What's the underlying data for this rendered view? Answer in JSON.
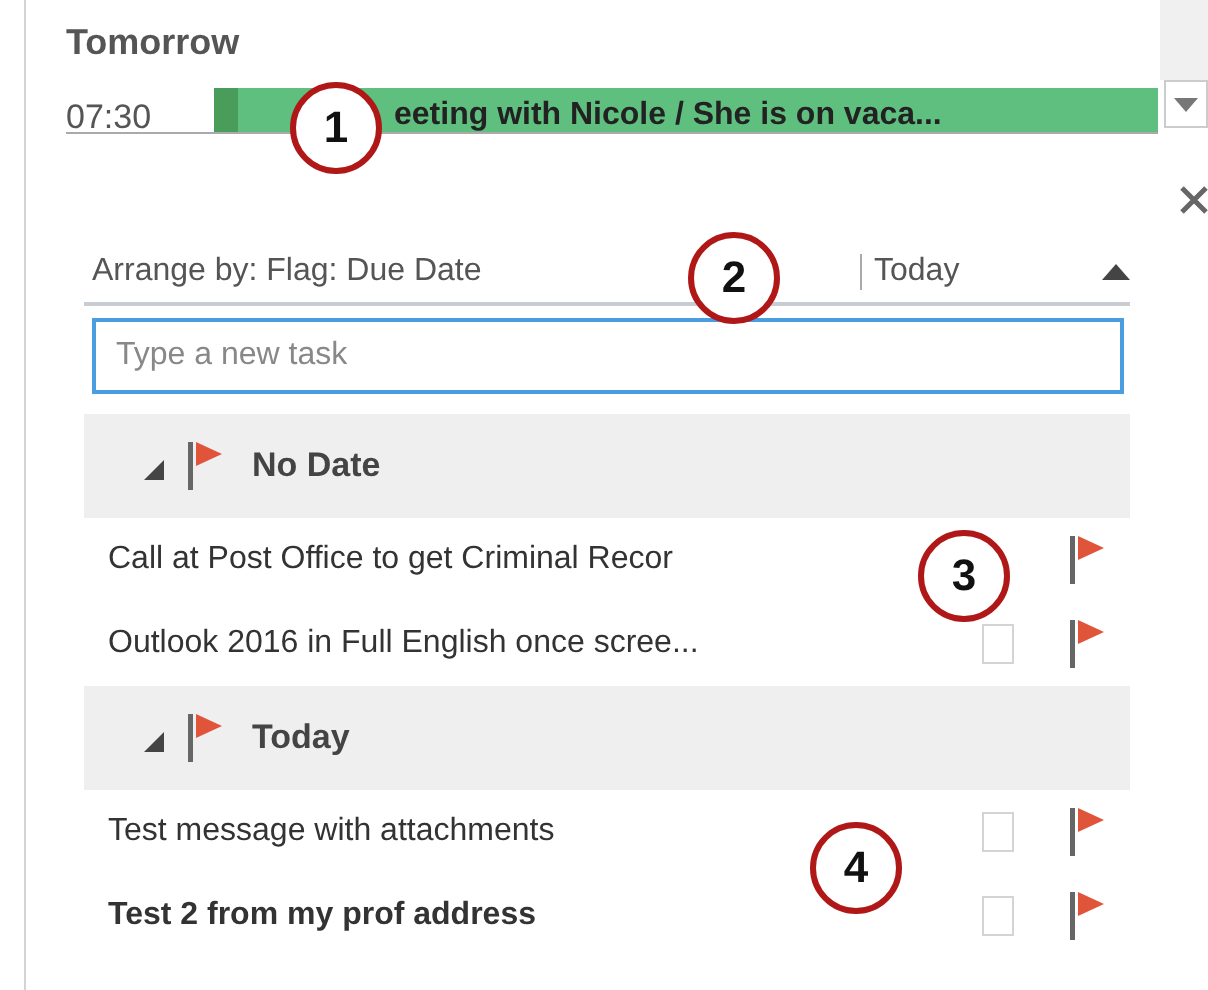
{
  "calendar": {
    "heading": "Tomorrow",
    "appointments": [
      {
        "time": "07:30",
        "title": "eeting with Nicole / She is on vaca...",
        "color": "#5fbf7f"
      }
    ]
  },
  "tasks": {
    "arrange_label": "Arrange by: Flag: Due Date",
    "sort_label": "Today",
    "new_task": {
      "placeholder": "Type a new task"
    },
    "groups": [
      {
        "title": "No Date",
        "expanded": true,
        "items": [
          {
            "title": "Call at Post Office to get Criminal Recor",
            "unread": false
          },
          {
            "title": "Outlook 2016 in Full English once scree...",
            "unread": false,
            "checked": false
          }
        ]
      },
      {
        "title": "Today",
        "expanded": true,
        "items": [
          {
            "title": "Test message with attachments",
            "unread": false,
            "checked": false
          },
          {
            "title": "Test 2 from my prof address",
            "unread": true,
            "checked": false
          }
        ]
      }
    ]
  },
  "callouts": [
    "1",
    "2",
    "3",
    "4"
  ]
}
